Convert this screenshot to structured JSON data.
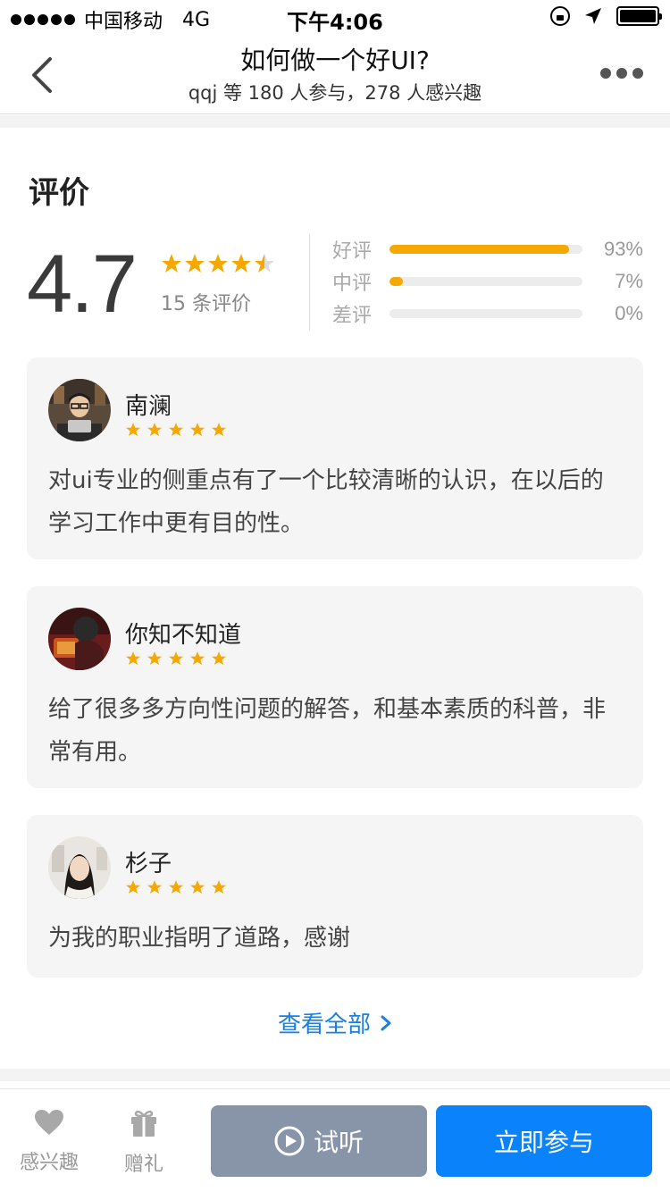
{
  "status_bar": {
    "carrier": "中国移动",
    "network": "4G",
    "time": "下午4:06"
  },
  "nav": {
    "title": "如何做一个好UI?",
    "subtitle": "qqj 等 180 人参与，278 人感兴趣"
  },
  "reviews": {
    "title": "评价",
    "score": "4.7",
    "count_text": "15 条评价",
    "distribution": [
      {
        "label": "好评",
        "percent_text": "93%",
        "percent": 93
      },
      {
        "label": "中评",
        "percent_text": "7%",
        "percent": 7
      },
      {
        "label": "差评",
        "percent_text": "0%",
        "percent": 0
      }
    ],
    "items": [
      {
        "name": "南澜",
        "stars": 5,
        "text": "对ui专业的侧重点有了一个比较清晰的认识，在以后的学习工作中更有目的性。"
      },
      {
        "name": "你知不知道",
        "stars": 5,
        "text": "给了很多多方向性问题的解答，和基本素质的科普，非常有用。"
      },
      {
        "name": "杉子",
        "stars": 5,
        "text": "为我的职业指明了道路，感谢"
      }
    ],
    "view_all": "查看全部"
  },
  "bottom_bar": {
    "interest_label": "感兴趣",
    "gift_label": "赠礼",
    "trial_label": "试听",
    "join_label": "立即参与"
  },
  "colors": {
    "accent_blue": "#0a82fa",
    "star_orange": "#f6a800",
    "trial_gray": "#8894a8"
  }
}
